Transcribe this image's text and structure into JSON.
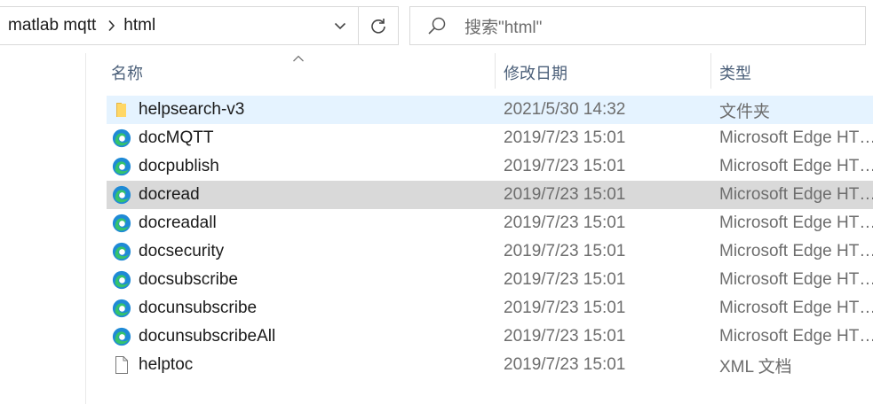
{
  "address_bar": {
    "crumbs": [
      "matlab mqtt",
      "html"
    ],
    "dropdown_icon": "chevron-down-icon",
    "refresh_icon": "refresh-icon"
  },
  "search": {
    "placeholder": "搜索\"html\"",
    "icon": "search-icon"
  },
  "columns": {
    "name": "名称",
    "date": "修改日期",
    "type": "类型"
  },
  "files": [
    {
      "name": "helpsearch-v3",
      "date": "2021/5/30 14:32",
      "type": "文件夹",
      "icon": "folder-icon",
      "state": "light-select"
    },
    {
      "name": "docMQTT",
      "date": "2019/7/23 15:01",
      "type": "Microsoft Edge HT…",
      "icon": "edge-icon",
      "state": ""
    },
    {
      "name": "docpublish",
      "date": "2019/7/23 15:01",
      "type": "Microsoft Edge HT…",
      "icon": "edge-icon",
      "state": ""
    },
    {
      "name": "docread",
      "date": "2019/7/23 15:01",
      "type": "Microsoft Edge HT…",
      "icon": "edge-icon",
      "state": "hover"
    },
    {
      "name": "docreadall",
      "date": "2019/7/23 15:01",
      "type": "Microsoft Edge HT…",
      "icon": "edge-icon",
      "state": ""
    },
    {
      "name": "docsecurity",
      "date": "2019/7/23 15:01",
      "type": "Microsoft Edge HT…",
      "icon": "edge-icon",
      "state": ""
    },
    {
      "name": "docsubscribe",
      "date": "2019/7/23 15:01",
      "type": "Microsoft Edge HT…",
      "icon": "edge-icon",
      "state": ""
    },
    {
      "name": "docunsubscribe",
      "date": "2019/7/23 15:01",
      "type": "Microsoft Edge HT…",
      "icon": "edge-icon",
      "state": ""
    },
    {
      "name": "docunsubscribeAll",
      "date": "2019/7/23 15:01",
      "type": "Microsoft Edge HT…",
      "icon": "edge-icon",
      "state": ""
    },
    {
      "name": "helptoc",
      "date": "2019/7/23 15:01",
      "type": "XML 文档",
      "icon": "document-icon",
      "state": ""
    }
  ]
}
